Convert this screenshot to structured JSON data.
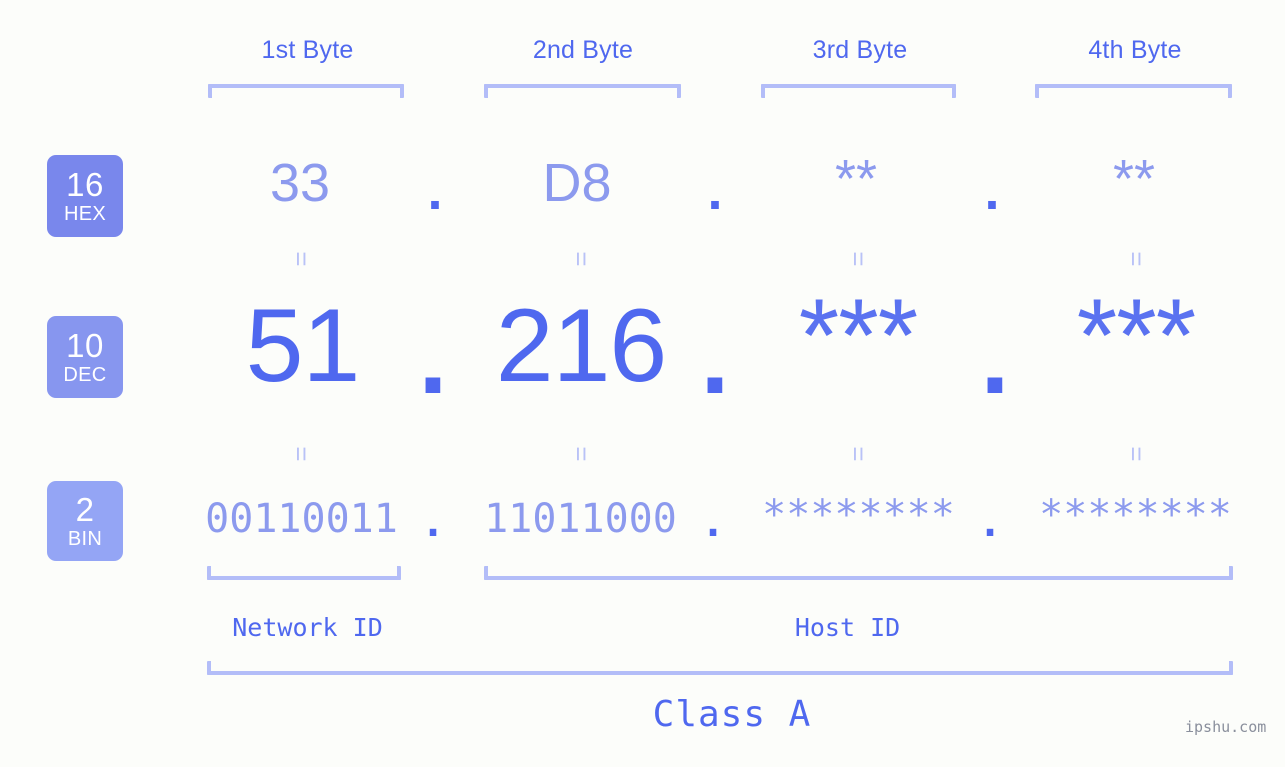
{
  "meta": {
    "watermark": "ipshu.com",
    "colors": {
      "background": "#fcfdfa",
      "accent_strong": "#4f68ef",
      "accent_light": "#8c9aee",
      "bracket": "#b3bdf8",
      "badge_hex": "#7987ec",
      "badge_dec": "#8796ef",
      "badge_bin": "#94a5f5",
      "equals": "#b9c2f7",
      "watermark": "#8a8f9c"
    }
  },
  "byte_headers": [
    {
      "label": "1st Byte"
    },
    {
      "label": "2nd Byte"
    },
    {
      "label": "3rd Byte"
    },
    {
      "label": "4th Byte"
    }
  ],
  "bases": [
    {
      "number": "16",
      "name": "HEX"
    },
    {
      "number": "10",
      "name": "DEC"
    },
    {
      "number": "2",
      "name": "BIN"
    }
  ],
  "rows": {
    "hex": {
      "values": [
        "33",
        "D8",
        "**",
        "**"
      ],
      "separator": "."
    },
    "dec": {
      "values": [
        "51",
        "216",
        "***",
        "***"
      ],
      "separator": "."
    },
    "bin": {
      "values": [
        "00110011",
        "11011000",
        "********",
        "********"
      ],
      "separator": "."
    }
  },
  "equals_symbol": "=",
  "segments": {
    "network_id": "Network ID",
    "host_id": "Host ID",
    "class": "Class A"
  }
}
